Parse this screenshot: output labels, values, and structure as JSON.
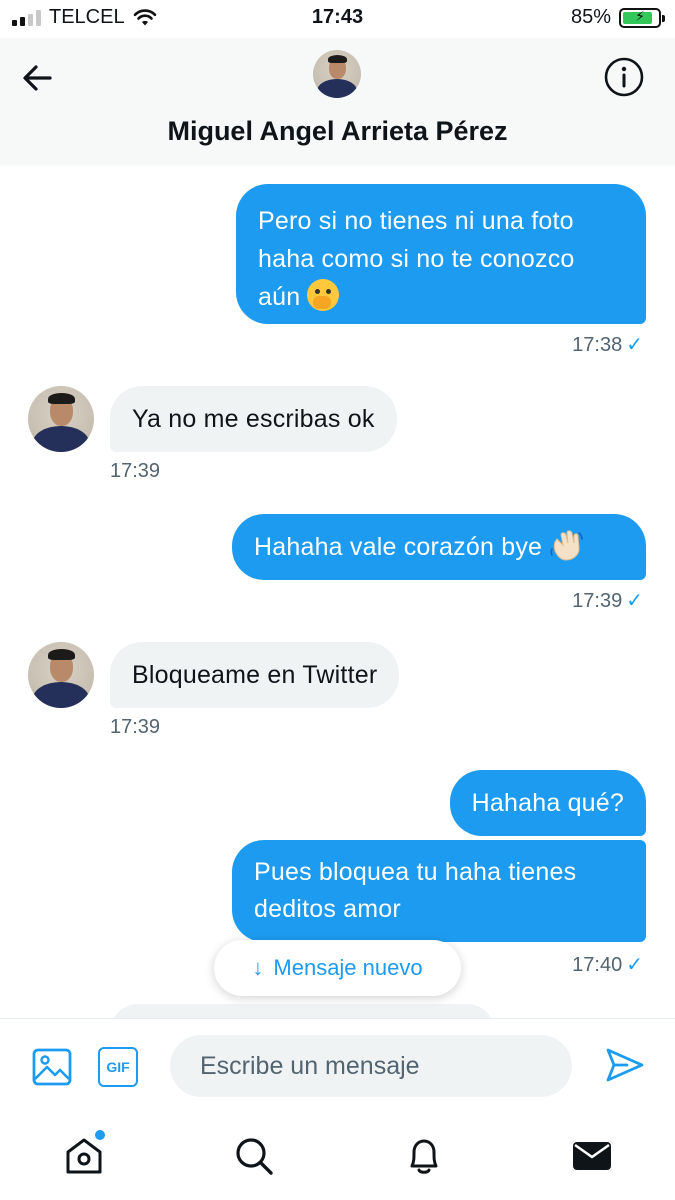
{
  "status_bar": {
    "carrier": "TELCEL",
    "time": "17:43",
    "battery": "85%"
  },
  "header": {
    "contact_name": "Miguel Angel Arrieta Pérez"
  },
  "messages": [
    {
      "direction": "out",
      "text_l1": "Pero si no tienes ni una foto",
      "text_l2": "haha como si no te conozco",
      "text_l3": "aún",
      "time": "17:38"
    },
    {
      "direction": "in",
      "text": "Ya no me escribas ok",
      "time": "17:39"
    },
    {
      "direction": "out",
      "text": "Hahaha vale corazón bye",
      "time": "17:39"
    },
    {
      "direction": "in",
      "text": "Bloqueame en Twitter",
      "time": "17:39"
    },
    {
      "direction": "out",
      "text": "Hahaha qué?"
    },
    {
      "direction": "out",
      "text_l1": "Pues bloquea tu haha tienes",
      "text_l2": "deditos amor",
      "time": "17:40"
    }
  ],
  "new_message_pill": {
    "arrow": "↓",
    "label": "Mensaje nuevo"
  },
  "composer": {
    "placeholder": "Escribe un mensaje",
    "gif_label": "GIF"
  },
  "colors": {
    "accent": "#1d9bf0",
    "incoming_bubble": "#eff3f4"
  }
}
